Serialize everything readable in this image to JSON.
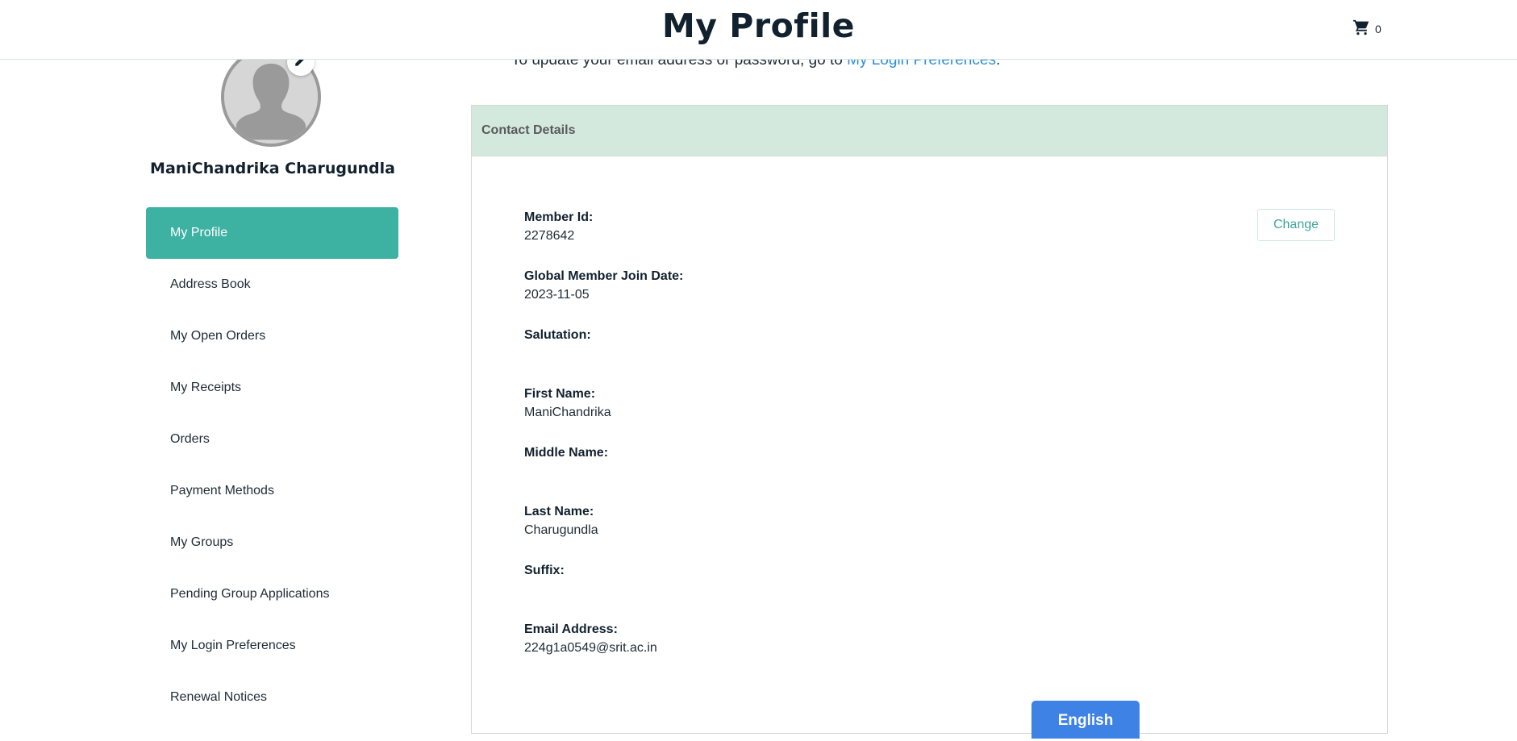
{
  "header": {
    "title": "My Profile",
    "cart_count": "0",
    "cart_icon": "shopping-cart-icon"
  },
  "sidebar": {
    "user_name": "ManiChandrika Charugundla",
    "avatar_icon": "person-silhouette",
    "edit_icon": "pencil-icon",
    "items": [
      {
        "label": "My Profile",
        "active": true
      },
      {
        "label": "Address Book"
      },
      {
        "label": "My Open Orders"
      },
      {
        "label": "My Receipts"
      },
      {
        "label": "Orders"
      },
      {
        "label": "Payment Methods"
      },
      {
        "label": "My Groups"
      },
      {
        "label": "Pending Group Applications"
      },
      {
        "label": "My Login Preferences"
      },
      {
        "label": "Renewal Notices"
      }
    ]
  },
  "main": {
    "intro_text": "To update your email address or password, go to",
    "intro_link": "My Login Preferences",
    "intro_end": ".",
    "panel_title": "Contact Details",
    "change_label": "Change",
    "fields": [
      {
        "label": "Member Id:",
        "value": "2278642"
      },
      {
        "label": "Global Member Join Date:",
        "value": "2023-11-05"
      },
      {
        "label": "Salutation:",
        "value": ""
      },
      {
        "label": "First Name:",
        "value": "ManiChandrika"
      },
      {
        "label": "Middle Name:",
        "value": ""
      },
      {
        "label": "Last Name:",
        "value": "Charugundla"
      },
      {
        "label": "Suffix:",
        "value": ""
      },
      {
        "label": "Email Address:",
        "value": "224g1a0549@srit.ac.in"
      }
    ]
  },
  "language_button": "English",
  "colors": {
    "accent": "#3db2a3",
    "link": "#2d8fd5",
    "panel_header": "#d4e9dd",
    "language_button": "#3e82e6"
  }
}
